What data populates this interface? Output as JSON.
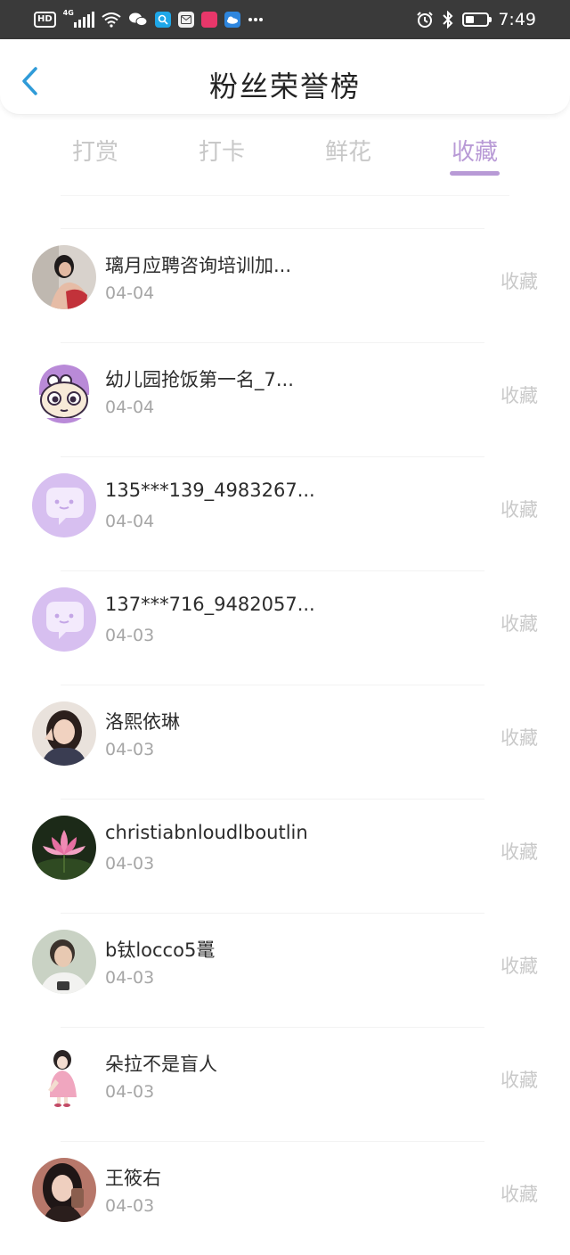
{
  "status_bar": {
    "hd": "HD",
    "network": "4G",
    "time": "7:49",
    "left_icons": [
      "hd-icon",
      "signal-icon",
      "wifi-icon",
      "wechat-icon",
      "search-app-icon",
      "mail-app-icon",
      "shop-app-icon",
      "weather-app-icon",
      "more-icon"
    ],
    "right_icons": [
      "alarm-icon",
      "bluetooth-icon",
      "battery-icon"
    ]
  },
  "header": {
    "title": "粉丝荣誉榜"
  },
  "tabs": [
    {
      "label": "打赏",
      "active": false
    },
    {
      "label": "打卡",
      "active": false
    },
    {
      "label": "鲜花",
      "active": false
    },
    {
      "label": "收藏",
      "active": true
    }
  ],
  "list": [
    {
      "name": "璃月应聘咨询培训加...",
      "date": "04-04",
      "action": "收藏",
      "avatar": "photo-avatar-1"
    },
    {
      "name": "幼儿园抢饭第一名_7...",
      "date": "04-04",
      "action": "收藏",
      "avatar": "cartoon-avatar"
    },
    {
      "name": "135***139_4983267...",
      "date": "04-04",
      "action": "收藏",
      "avatar": "default-chat-avatar"
    },
    {
      "name": "137***716_9482057...",
      "date": "04-03",
      "action": "收藏",
      "avatar": "default-chat-avatar"
    },
    {
      "name": "洛熙依琳",
      "date": "04-03",
      "action": "收藏",
      "avatar": "photo-avatar-2"
    },
    {
      "name": "christiabnloudlboutlin",
      "date": "04-03",
      "action": "收藏",
      "avatar": "lotus-avatar"
    },
    {
      "name": "b钛locco5鼍",
      "date": "04-03",
      "action": "收藏",
      "avatar": "photo-avatar-3"
    },
    {
      "name": "朵拉不是盲人",
      "date": "04-03",
      "action": "收藏",
      "avatar": "illustration-avatar"
    },
    {
      "name": "王筱右",
      "date": "04-03",
      "action": "收藏",
      "avatar": "photo-avatar-4"
    }
  ],
  "colors": {
    "accent": "#b89ad6",
    "back_arrow": "#2f9bd8",
    "muted": "#c9c9c9"
  }
}
